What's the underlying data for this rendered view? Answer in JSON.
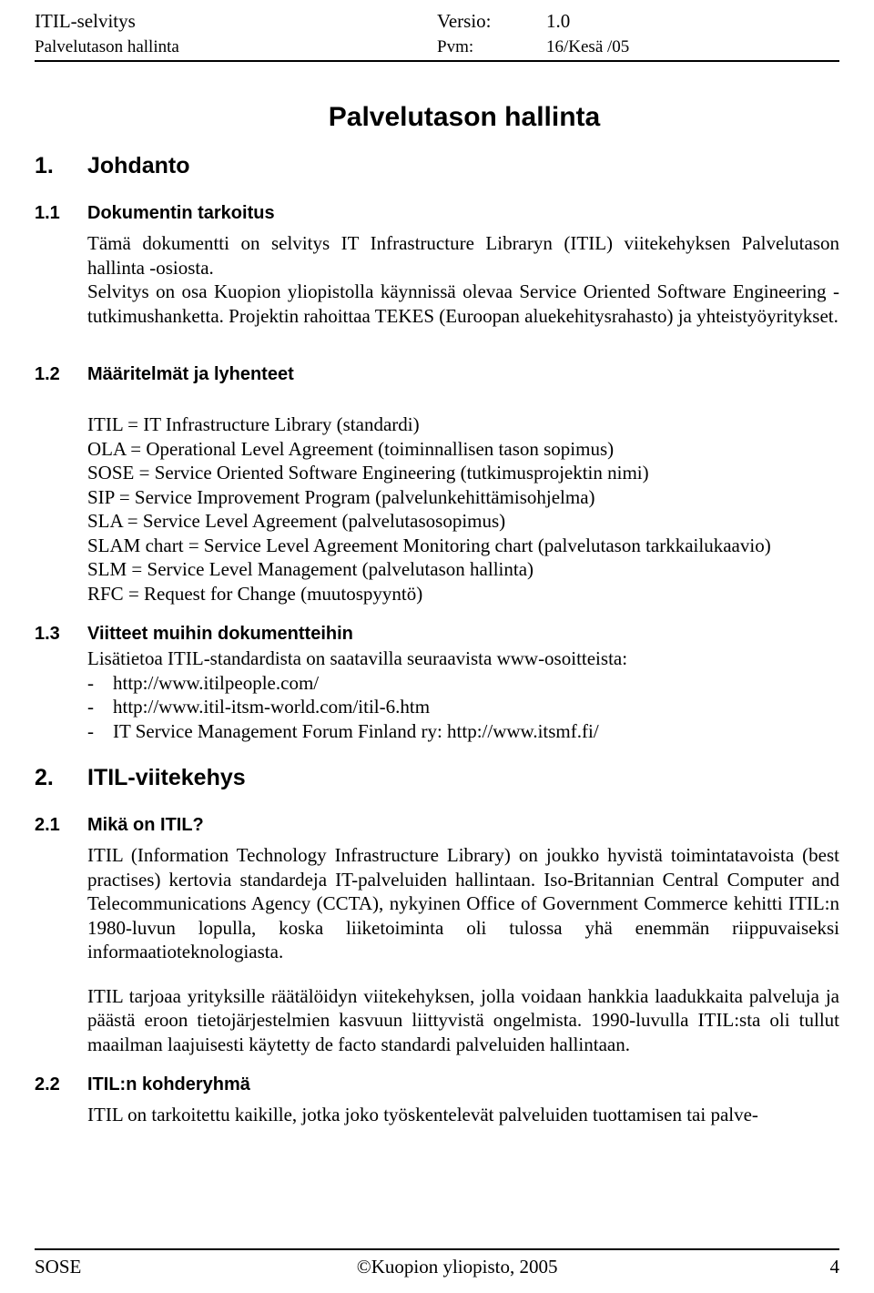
{
  "header": {
    "doc_name": "ITIL-selvitys",
    "subtitle": "Palvelutason hallinta",
    "version_label": "Versio:",
    "version_value": "1.0",
    "date_label": "Pvm:",
    "date_value": "16/Kesä /05"
  },
  "title": "Palvelutason hallinta",
  "sections": {
    "s1": {
      "num": "1.",
      "title": "Johdanto"
    },
    "s1_1": {
      "num": "1.1",
      "title": "Dokumentin tarkoitus",
      "p1": "Tämä dokumentti on selvitys IT Infrastructure Libraryn (ITIL) viitekehyksen Palvelutason hallinta -osiosta.",
      "p2": "Selvitys on osa Kuopion yliopistolla käynnissä olevaa Service Oriented Software Engineering -tutkimushanketta. Projektin rahoittaa TEKES (Euroopan aluekehitysrahasto) ja yhteistyöyritykset."
    },
    "s1_2": {
      "num": "1.2",
      "title": "Määritelmät ja lyhenteet",
      "definitions": [
        "ITIL = IT Infrastructure Library (standardi)",
        "OLA = Operational Level Agreement (toiminnallisen tason sopimus)",
        "SOSE = Service Oriented Software Engineering (tutkimusprojektin nimi)",
        "SIP = Service Improvement Program (palvelunkehittämisohjelma)",
        "SLA = Service Level Agreement (palvelutasosopimus)",
        "SLAM chart = Service Level Agreement Monitoring chart (palvelutason tarkkailukaavio)",
        "SLM = Service Level Management (palvelutason hallinta)",
        "RFC = Request for Change (muutospyyntö)"
      ]
    },
    "s1_3": {
      "num": "1.3",
      "title": "Viitteet muihin dokumentteihin",
      "intro": "Lisätietoa ITIL-standardista on saatavilla seuraavista www-osoitteista:",
      "links": [
        "http://www.itilpeople.com/",
        "http://www.itil-itsm-world.com/itil-6.htm",
        "IT Service Management Forum Finland ry: http://www.itsmf.fi/"
      ],
      "bullet": "-"
    },
    "s2": {
      "num": "2.",
      "title": "ITIL-viitekehys"
    },
    "s2_1": {
      "num": "2.1",
      "title": "Mikä on ITIL?",
      "p1": "ITIL (Information Technology Infrastructure Library) on joukko hyvistä toimintatavoista (best practises) kertovia standardeja IT-palveluiden hallintaan. Iso-Britannian Central Computer and Telecommunications Agency (CCTA), nykyinen Office of Government Commerce kehitti ITIL:n 1980-luvun lopulla, koska liiketoiminta oli tulossa yhä enemmän riippuvaiseksi informaatioteknologiasta.",
      "p2": "ITIL tarjoaa yrityksille räätälöidyn viitekehyksen, jolla voidaan hankkia laadukkaita palveluja ja päästä eroon tietojärjestelmien kasvuun liittyvistä ongelmista. 1990-luvulla ITIL:sta oli tullut maailman laajuisesti käytetty de facto standardi palveluiden hallintaan."
    },
    "s2_2": {
      "num": "2.2",
      "title": "ITIL:n kohderyhmä",
      "p1": "ITIL on tarkoitettu kaikille, jotka joko työskentelevät palveluiden tuottamisen tai  palve-"
    }
  },
  "footer": {
    "left": "SOSE",
    "center": "©Kuopion yliopisto, 2005",
    "right": "4"
  }
}
